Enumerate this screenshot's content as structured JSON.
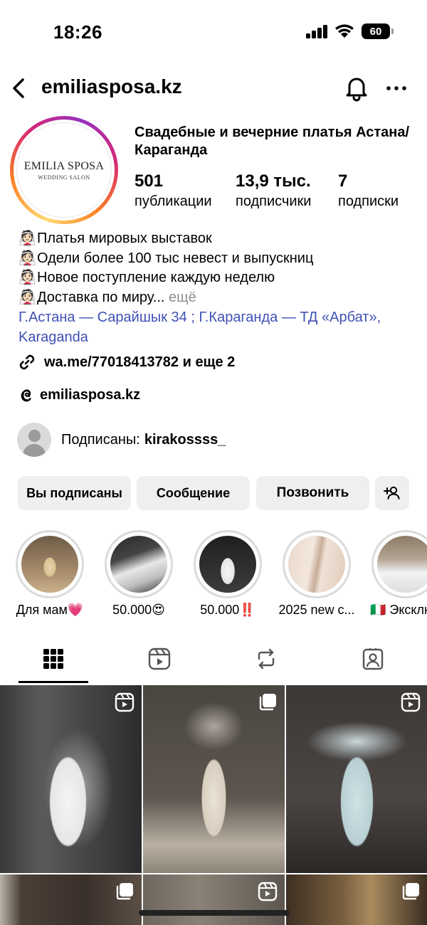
{
  "status_bar": {
    "time": "18:26",
    "battery": "60"
  },
  "header": {
    "username": "emiliasposa.kz"
  },
  "profile": {
    "logo_main": "EMILIA SPOSA",
    "logo_sub": "WEDDING SALON",
    "display_name": "Свадебные и вечерние платья Астана/Караганда",
    "stats": [
      {
        "value": "501",
        "label": "публикации"
      },
      {
        "value": "13,9 тыс.",
        "label": "подписчики"
      },
      {
        "value": "7",
        "label": "подписки"
      }
    ]
  },
  "bio": {
    "emoji": "👰🏻",
    "lines": [
      "Платья мировых выставок",
      "Одели более 100 тыс невест и выпускниц",
      "Новое поступление каждую неделю",
      "Доставка по миру..."
    ],
    "more": "ещё",
    "location": "Г.Астана — Сарайшык 34 ; Г.Караганда — ТД «Арбат», Karaganda",
    "link": "wa.me/77018413782 и еще 2",
    "threads": "emiliasposa.kz"
  },
  "followed_by": {
    "prefix": "Подписаны:",
    "name": "kirakossss_"
  },
  "buttons": {
    "following": "Вы подписаны",
    "message": "Сообщение",
    "call": "Позвонить"
  },
  "highlights": [
    {
      "label": "Для мам💗"
    },
    {
      "label": "50.000😍"
    },
    {
      "label": "50.000‼️"
    },
    {
      "label": "2025 new c..."
    },
    {
      "label": "🇮🇹 Эксклю"
    }
  ],
  "tabs": [
    "grid-icon",
    "reels-icon",
    "reposts-icon",
    "tagged-icon"
  ],
  "colors": {
    "link_blue": "#3f51b5",
    "button_bg": "#efefef",
    "muted": "#8e8e8e"
  }
}
